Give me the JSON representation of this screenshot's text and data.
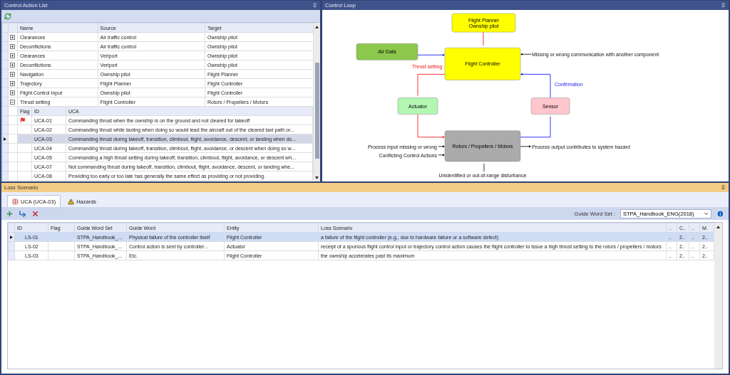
{
  "control_action_list": {
    "title": "Control Action List",
    "columns": [
      "Name",
      "Source",
      "Target"
    ],
    "rows": [
      {
        "name": "Clearances",
        "source": "Air traffic control",
        "target": "Ownship pilot",
        "expanded": false
      },
      {
        "name": "Deconflictions",
        "source": "Air traffic control",
        "target": "Ownship pilot",
        "expanded": false
      },
      {
        "name": "Clearances",
        "source": "Veriport",
        "target": "Ownship pilot",
        "expanded": false
      },
      {
        "name": "Deconflictions",
        "source": "Veriport",
        "target": "Ownship pilot",
        "expanded": false
      },
      {
        "name": "Navigation",
        "source": "Ownship pilot",
        "target": "Flight Planner",
        "expanded": false
      },
      {
        "name": "Trajectory",
        "source": "Flight Planner",
        "target": "Flight Controller",
        "expanded": false
      },
      {
        "name": "Flight Control Input",
        "source": "Ownship pilot",
        "target": "Flight Controller",
        "expanded": false
      },
      {
        "name": "Thrust setting",
        "source": "Flight Controller",
        "target": "Rotors / Propellers / Motors",
        "expanded": true,
        "uca_table": {
          "columns": [
            "Flag",
            "ID",
            "UCA"
          ],
          "rows": [
            {
              "flagged": true,
              "id": "UCA-01",
              "uca": "Commanding thrust when the ownship is on the ground and not cleared for takeoff",
              "selected": false
            },
            {
              "flagged": false,
              "id": "UCA-02",
              "uca": "Commanding thrust while taxiing when doing so would lead the aircraft out of the cleared taxi path or...",
              "selected": false
            },
            {
              "flagged": false,
              "id": "UCA-03",
              "uca": "Commanding thrust during takeoff, transition, climbout, flight, avoidance, descent, or landing when do...",
              "selected": true
            },
            {
              "flagged": false,
              "id": "UCA-04",
              "uca": "Commanding thrust during takeoff, transition, climbout, flight, avoidance, or descent when doing so w...",
              "selected": false
            },
            {
              "flagged": false,
              "id": "UCA-05",
              "uca": "Commanding a high thrust setting during takeoff, transition, climbout, flight, avoidance, or descent wh...",
              "selected": false
            },
            {
              "flagged": false,
              "id": "UCA-07",
              "uca": "Not commanding thrust during takeoff, transition, climbout, flight, avoidance, descent, or landing whe...",
              "selected": false
            },
            {
              "flagged": false,
              "id": "UCA-08",
              "uca": "Providing too early or too late has generally the same effect as providing or not providing.",
              "selected": false
            }
          ]
        }
      }
    ]
  },
  "control_loop": {
    "title": "Control Loop",
    "nodes": [
      {
        "lines": [
          "Flight Planner",
          "Ownship pilot"
        ],
        "color": "#ffff00"
      },
      {
        "lines": [
          "Air Data"
        ],
        "color": "#8cc84b"
      },
      {
        "lines": [
          "Flight Controller"
        ],
        "color": "#ffff00"
      },
      {
        "lines": [
          "Actuator"
        ],
        "color": "#b3f7b3"
      },
      {
        "lines": [
          "Sensor"
        ],
        "color": "#ffc6cc"
      },
      {
        "lines": [
          "Rotors / Propellers / Motors"
        ],
        "color": "#ababab"
      }
    ],
    "labels": [
      {
        "text": "Missing or wrong communication with another component",
        "kind": "note"
      },
      {
        "text": "Thrust setting",
        "kind": "control"
      },
      {
        "text": "Confirmation",
        "kind": "feedback"
      },
      {
        "text": "Process input missing or wrong",
        "kind": "note"
      },
      {
        "text": "Conflicting Control Actions",
        "kind": "note"
      },
      {
        "text": "Process output contributes to system hazard",
        "kind": "note"
      },
      {
        "text": "Unidentified or out-of-range disturbance",
        "kind": "note"
      }
    ]
  },
  "loss_scenario": {
    "title": "Loss Scenario",
    "tabs": [
      {
        "label": "UCA (UCA-03)",
        "kind": "table",
        "selected": true
      },
      {
        "label": "Hazards",
        "kind": "warning",
        "selected": false
      }
    ],
    "guide_word_set": {
      "label": "Guide Word Set :",
      "value": "STPA_Handbook_ENG(2018)"
    },
    "columns": [
      "ID",
      "Flag",
      "Guide Word Set",
      "Guide Word",
      "Entity",
      "Loss Scenario",
      "..",
      "C..",
      "..",
      "M."
    ],
    "rows": [
      {
        "cells": [
          "LS-01",
          "",
          "STPA_Handbook_...",
          "Physical failure of the controller itself",
          "Flight Controller",
          "a failure of the flight controller (e.g., due to hardware failure or a software defect)",
          "..",
          "2..",
          "..",
          "2.."
        ],
        "selected": true
      },
      {
        "cells": [
          "LS-02",
          "",
          "STPA_Handbook_...",
          "Control action is sent by controller...",
          "Actuator",
          "receipt of a spurious flight control input or trajectory control action causes the flight controller to issue a high thrust setting to the rotors / propellers / motors",
          "..",
          "2..",
          "..",
          "2.."
        ],
        "selected": false
      },
      {
        "cells": [
          "LS-03",
          "",
          "STPA_Handbook_...",
          "Etc.",
          "Flight Controller",
          "the ownship accelerates past its maximum",
          "..",
          "2..",
          "..",
          "2.."
        ],
        "selected": false
      }
    ]
  }
}
